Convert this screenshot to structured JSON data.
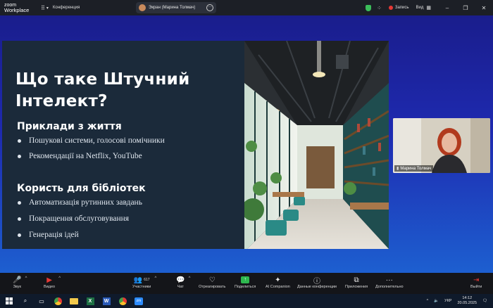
{
  "titlebar": {
    "logo_line1": "zoom",
    "logo_line2": "Workplace",
    "conference_label": "Конференция",
    "screen_share_label": "Экран (Марина Толмач)",
    "record_label": "Запись",
    "view_label": "Вид"
  },
  "slide": {
    "title": "Що таке Штучний Інтелект?",
    "section1_title": "Приклади з життя",
    "section1_items": [
      "Пошукові системи, голосові помічники",
      "Рекомендації на Netflix, YouTube"
    ],
    "section2_title": "Користь для бібліотек",
    "section2_items": [
      "Автоматизація рутинних завдань",
      "Покращення обслуговування",
      "Генерація ідей"
    ]
  },
  "video": {
    "participant_name": "Марина Толмач"
  },
  "toolbar": {
    "audio_label": "Звук",
    "video_label": "Видео",
    "participants_label": "Участники",
    "participants_count": "617",
    "chat_label": "Чат",
    "react_label": "Отреагировать",
    "share_label": "Поделиться",
    "ai_label": "AI Companion",
    "info_label": "Данные конференции",
    "apps_label": "Приложения",
    "more_label": "Дополнительно",
    "leave_label": "Выйти"
  },
  "taskbar": {
    "lang": "УКР",
    "time": "14:12",
    "date": "20.05.2025"
  },
  "colors": {
    "accent_red": "#e53935",
    "share_green": "#2eb84f",
    "slide_bg": "#1b2a3a"
  }
}
